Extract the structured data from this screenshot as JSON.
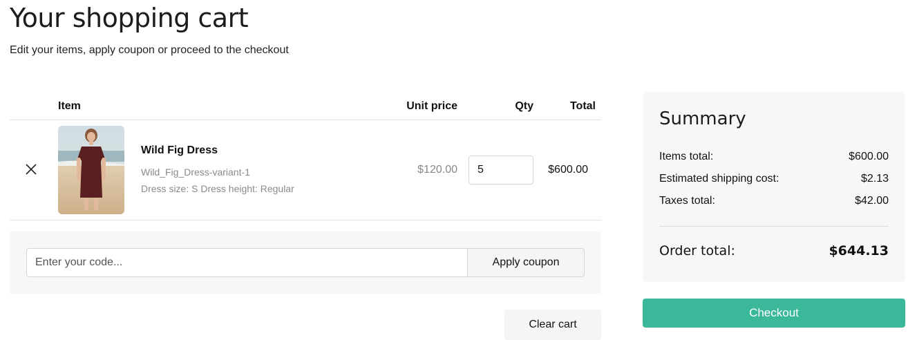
{
  "header": {
    "title": "Your shopping cart",
    "subtitle": "Edit your items, apply coupon or proceed to the checkout"
  },
  "cart": {
    "columns": {
      "item": "Item",
      "unit_price": "Unit price",
      "qty": "Qty",
      "total": "Total"
    },
    "items": [
      {
        "name": "Wild Fig Dress",
        "sku": "Wild_Fig_Dress-variant-1",
        "variant": "Dress size: S Dress height: Regular",
        "unit_price": "$120.00",
        "qty": "5",
        "total": "$600.00"
      }
    ]
  },
  "coupon": {
    "placeholder": "Enter your code...",
    "apply_label": "Apply coupon"
  },
  "clear_cart_label": "Clear cart",
  "summary": {
    "title": "Summary",
    "items_total_label": "Items total:",
    "items_total_value": "$600.00",
    "shipping_label": "Estimated shipping cost:",
    "shipping_value": "$2.13",
    "taxes_label": "Taxes total:",
    "taxes_value": "$42.00",
    "order_total_label": "Order total:",
    "order_total_value": "$644.13"
  },
  "checkout_label": "Checkout",
  "colors": {
    "accent": "#3bb79a",
    "panel_bg": "#f6f7f8",
    "muted_text": "#8a8a8a"
  },
  "icons": {
    "remove": "close-icon",
    "product_image": "dress-product-photo"
  }
}
